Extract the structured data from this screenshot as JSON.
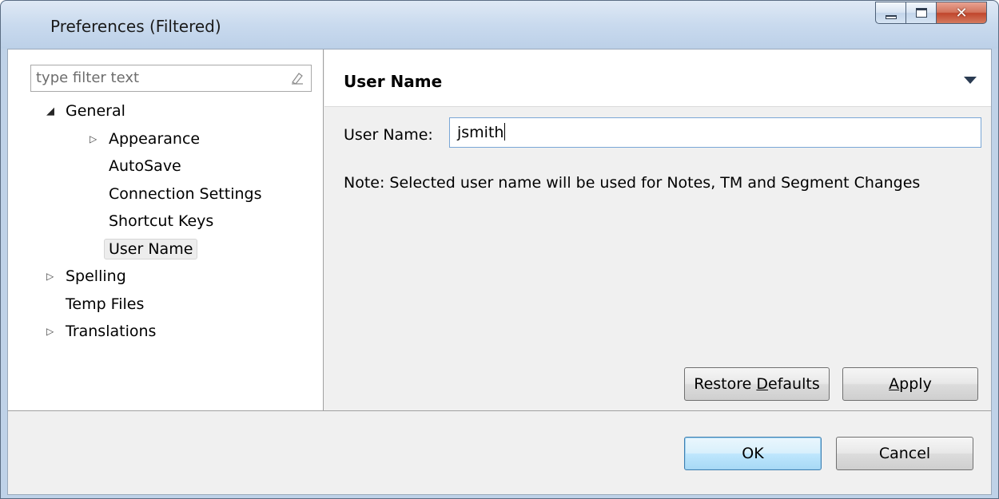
{
  "window": {
    "title": "Preferences (Filtered)",
    "controls": {
      "minimize": "minimize-icon",
      "maximize": "maximize-icon",
      "close": "close-icon"
    }
  },
  "sidebar": {
    "filter_placeholder": "type filter text",
    "tree": [
      {
        "label": "General",
        "level": 0,
        "expander": "expanded"
      },
      {
        "label": "Appearance",
        "level": 1,
        "expander": "collapsed"
      },
      {
        "label": "AutoSave",
        "level": 1,
        "expander": "none"
      },
      {
        "label": "Connection Settings",
        "level": 1,
        "expander": "none"
      },
      {
        "label": "Shortcut Keys",
        "level": 1,
        "expander": "none"
      },
      {
        "label": "User Name",
        "level": 1,
        "expander": "none",
        "selected": true
      },
      {
        "label": "Spelling",
        "level": 0,
        "expander": "collapsed"
      },
      {
        "label": "Temp Files",
        "level": 0,
        "expander": "none"
      },
      {
        "label": "Translations",
        "level": 0,
        "expander": "collapsed"
      }
    ]
  },
  "page": {
    "title": "User Name",
    "field_label": "User Name:",
    "field_value": "jsmith",
    "note": "Note: Selected user name will be used for Notes, TM and Segment Changes",
    "restore_pre": "Restore ",
    "restore_key": "D",
    "restore_post": "efaults",
    "apply_key": "A",
    "apply_post": "pply"
  },
  "footer": {
    "ok_label": "OK",
    "cancel_label": "Cancel"
  },
  "colors": {
    "titlebar": "#c9daee",
    "default_button": "#bee6fd",
    "close_button": "#c0452c",
    "selection": "#ededed"
  }
}
